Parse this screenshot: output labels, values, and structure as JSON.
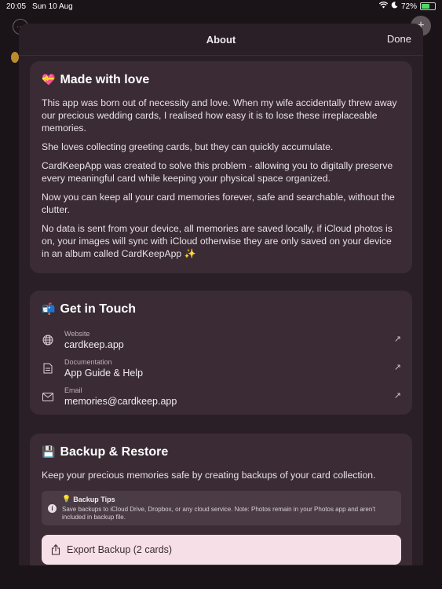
{
  "status_bar": {
    "time": "20:05",
    "date": "Sun 10 Aug",
    "battery_percent": "72%",
    "battery_level": 0.72
  },
  "sheet": {
    "title": "About",
    "done_label": "Done"
  },
  "made_with_love": {
    "emoji": "💝",
    "title": "Made with love",
    "paragraphs": [
      "This app was born out of necessity and love. When my wife accidentally threw away our precious wedding cards, I realised how easy it is to lose these irreplaceable memories.",
      "She loves collecting greeting cards, but they can quickly accumulate.",
      "CardKeepApp was created to solve this problem - allowing you to digitally preserve every meaningful card while keeping your physical space organized.",
      "Now you can keep all your card memories forever, safe and searchable, without the clutter.",
      "No data is sent from your device, all memories are saved locally, if iCloud photos is on, your images will sync with iCloud otherwise they are only saved on your device in an album called CardKeepApp ✨"
    ]
  },
  "get_in_touch": {
    "emoji": "📬",
    "title": "Get in Touch",
    "items": [
      {
        "label": "Website",
        "value": "cardkeep.app",
        "icon": "globe-icon"
      },
      {
        "label": "Documentation",
        "value": "App Guide & Help",
        "icon": "document-icon"
      },
      {
        "label": "Email",
        "value": "memories@cardkeep.app",
        "icon": "envelope-icon"
      }
    ]
  },
  "backup": {
    "emoji": "💾",
    "title": "Backup & Restore",
    "description": "Keep your precious memories safe by creating backups of your card collection.",
    "tips_title": "Backup Tips",
    "tips_emoji": "💡",
    "tips_text": "Save backups to iCloud Drive, Dropbox, or any cloud service. Note: Photos remain in your Photos app and aren't included in backup file.",
    "export_label": "Export Backup (2 cards)"
  },
  "colors": {
    "sheet_bg": "#2a1f26",
    "card_bg": "#3a2b34",
    "export_button_bg": "#f6dfe6",
    "battery_fill": "#4cd964"
  }
}
